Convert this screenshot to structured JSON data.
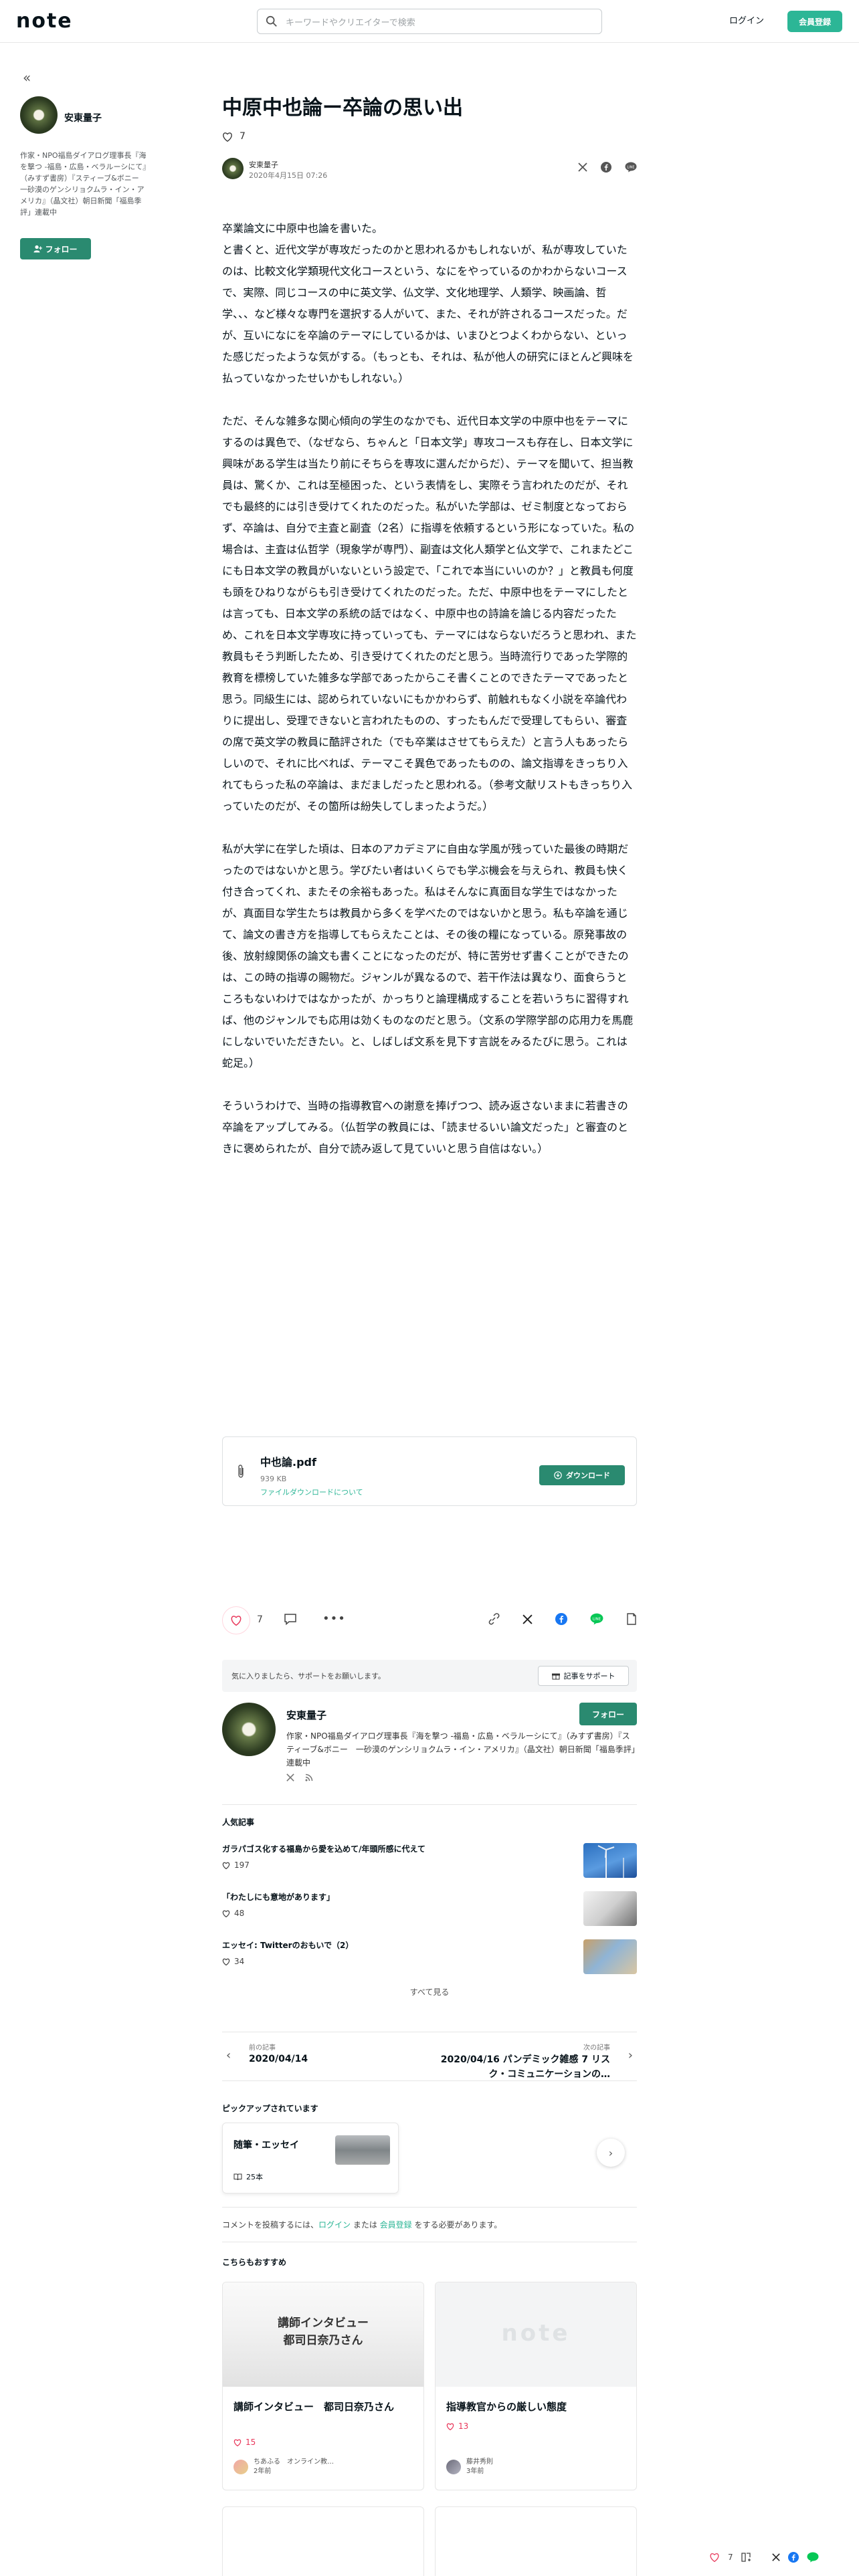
{
  "header": {
    "logo": "note",
    "search_placeholder": "キーワードやクリエイターで検索",
    "login": "ログイン",
    "register": "会員登録"
  },
  "sidebar": {
    "collapse": "«",
    "name": "安東量子",
    "bio": "作家・NPO福島ダイアログ理事長『海を撃つ -福島・広島・ベラルーシにて』（みすず書房）『スティーブ&ボニー　一砂漠のゲンシリョクムラ・イン・アメリカ』（晶文社）朝日新聞「福島季評」連載中",
    "follow": "フォロー"
  },
  "article": {
    "title": "中原中也論ー卒論の思い出",
    "likes": "7",
    "author": "安東量子",
    "date": "2020年4月15日 07:26",
    "paragraphs": [
      "卒業論文に中原中也論を書いた。\nと書くと、近代文学が専攻だったのかと思われるかもしれないが、私が専攻していたのは、比較文化学類現代文化コースという、なにをやっているのかわからないコースで、実際、同じコースの中に英文学、仏文学、文化地理学、人類学、映画論、哲学、、、など様々な専門を選択する人がいて、また、それが許されるコースだった。だが、互いになにを卒論のテーマにしているかは、いまひとつよくわからない、といった感じだったような気がする。（もっとも、それは、私が他人の研究にほとんど興味を払っていなかったせいかもしれない。）",
      "ただ、そんな雑多な関心傾向の学生のなかでも、近代日本文学の中原中也をテーマにするのは異色で、（なぜなら、ちゃんと「日本文学」専攻コースも存在し、日本文学に興味がある学生は当たり前にそちらを専攻に選んだからだ）、テーマを聞いて、担当教員は、驚くか、これは至極困った、という表情をし、実際そう言われたのだが、それでも最終的には引き受けてくれたのだった。私がいた学部は、ゼミ制度となっておらず、卒論は、自分で主査と副査（2名）に指導を依頼するという形になっていた。私の場合は、主査は仏哲学（現象学が専門）、副査は文化人類学と仏文学で、これまたどこにも日本文学の教員がいないという設定で、「これで本当にいいのか？」と教員も何度も頭をひねりながらも引き受けてくれたのだった。ただ、中原中也をテーマにしたとは言っても、日本文学の系統の話ではなく、中原中也の詩論を論じる内容だったため、これを日本文学専攻に持っていっても、テーマにはならないだろうと思われ、また教員もそう判断したため、引き受けてくれたのだと思う。当時流行りであった学際的教育を標榜していた雑多な学部であったからこそ書くことのできたテーマであったと思う。同級生には、認められていないにもかかわらず、前触れもなく小説を卒論代わりに提出し、受理できないと言われたものの、すったもんだで受理してもらい、審査の席で英文学の教員に酷評された（でも卒業はさせてもらえた）と言う人もあったらしいので、それに比べれば、テーマこそ異色であったものの、論文指導をきっちり入れてもらった私の卒論は、まだましだったと思われる。（参考文献リストもきっちり入っていたのだが、その箇所は紛失してしまったようだ。）",
      "私が大学に在学した頃は、日本のアカデミアに自由な学風が残っていた最後の時期だったのではないかと思う。学びたい者はいくらでも学ぶ機会を与えられ、教員も快く付き合ってくれ、またその余裕もあった。私はそんなに真面目な学生ではなかったが、真面目な学生たちは教員から多くを学べたのではないかと思う。私も卒論を通じて、論文の書き方を指導してもらえたことは、その後の糧になっている。原発事故の後、放射線関係の論文も書くことになったのだが、特に苦労せず書くことができたのは、この時の指導の賜物だ。ジャンルが異なるので、若干作法は異なり、面食らうところもないわけではなかったが、かっちりと論理構成することを若いうちに習得すれば、他のジャンルでも応用は効くものなのだと思う。（文系の学際学部の応用力を馬鹿にしないでいただきたい。と、しばしば文系を見下す言説をみるたびに思う。これは蛇足。）",
      "そういうわけで、当時の指導教官への謝意を捧げつつ、読み返さないままに若書きの卒論をアップしてみる。（仏哲学の教員には、「読ませるいい論文だった」と審査のときに褒められたが、自分で読み返して見ていいと思う自信はない。）"
    ]
  },
  "file": {
    "name": "中也論.pdf",
    "size": "939 KB",
    "about": "ファイルダウンロードについて",
    "download": "ダウンロード"
  },
  "actions": {
    "likes": "7"
  },
  "support": {
    "text": "気に入りましたら、サポートをお願いします。",
    "button": "記事をサポート"
  },
  "creator": {
    "name": "安東量子",
    "follow": "フォロー",
    "bio": "作家・NPO福島ダイアログ理事長『海を撃つ -福島・広島・ベラルーシにて』（みすず書房）『スティーブ&ボニー　一砂漠のゲンシリョクムラ・イン・アメリカ』（晶文社）朝日新聞「福島季評」連載中"
  },
  "popular": {
    "heading": "人気記事",
    "items": [
      {
        "title": "ガラパゴス化する福島から愛を込めて/年頭所感に代えて",
        "likes": "197"
      },
      {
        "title": "「わたしにも意地があります」",
        "likes": "48"
      },
      {
        "title": "エッセイ: Twitterのおもいで（2）",
        "likes": "34"
      }
    ],
    "see_all": "すべて見る"
  },
  "pager": {
    "prev_label": "前の記事",
    "prev_title": "2020/04/14",
    "next_label": "次の記事",
    "next_title": "2020/04/16 パンデミック雑感 7 リスク・コミュニケーションの…"
  },
  "pickup": {
    "heading": "ピックアップされています",
    "title": "随筆・エッセイ",
    "count": "25本"
  },
  "comment": {
    "prefix": "コメントを投稿するには、",
    "login": "ログイン",
    "middle": " または ",
    "register": "会員登録",
    "suffix": " をする必要があります。"
  },
  "recommend": {
    "heading": "こちらもおすすめ",
    "cards": [
      {
        "image_text": "講師インタビュー\n都司日奈乃さん",
        "title": "講師インタビュー　都司日奈乃さん",
        "likes": "15",
        "author": "ちあふる　オンライン教…",
        "time": "2年前"
      },
      {
        "image_text": "note",
        "title": "指導教官からの厳しい態度",
        "likes": "13",
        "author": "藤井秀則",
        "time": "3年前"
      }
    ]
  },
  "floating": {
    "likes": "7"
  },
  "colors": {
    "accent": "#2cb696",
    "follow_green": "#2a8a70",
    "like_red": "#e8375a"
  }
}
